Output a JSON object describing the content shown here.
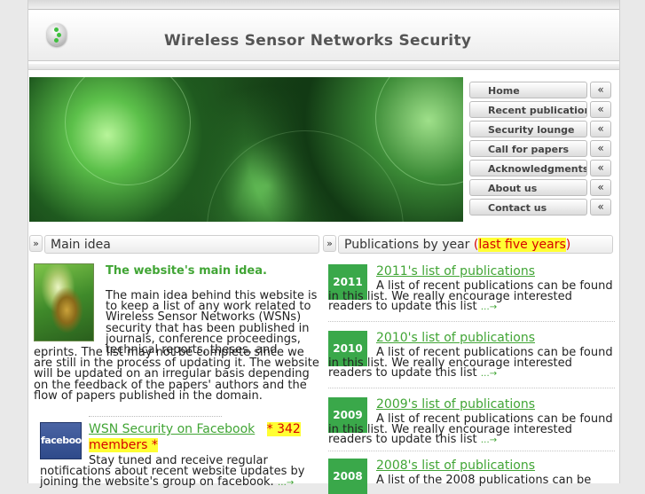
{
  "header": {
    "site_title": "Wireless Sensor Networks Security"
  },
  "nav": {
    "items": [
      {
        "label": "Home",
        "arrow": "«"
      },
      {
        "label": "Recent publications",
        "arrow": "«"
      },
      {
        "label": "Security lounge",
        "arrow": "«"
      },
      {
        "label": "Call for papers",
        "arrow": "«"
      },
      {
        "label": "Acknowledgments",
        "arrow": "«"
      },
      {
        "label": "About us",
        "arrow": "«"
      },
      {
        "label": "Contact us",
        "arrow": "«"
      }
    ]
  },
  "left": {
    "head_arrow": "»",
    "head_title": "Main idea",
    "idea_title": "The website's main idea.",
    "idea_text_1": "The main idea behind this website is to keep a list of  any work related to Wireless Sensor Networks (WSNs) security that has been published in journals, conference proceedings, technical reports, theses, and",
    "idea_text_2": "eprints. The list may not be complete since we are still in the process of updating it. The website will be updated on an irregular basis depending on the feedback of the papers' authors and the flow of papers published in the domain.",
    "fb_logo_text": "facebook",
    "fb_title": "WSN Security on Facebook",
    "fb_members": "* 342 members *",
    "fb_text": "Stay tuned and receive regular notifications about recent website updates by joining the website's group on facebook.",
    "more_link": "…→"
  },
  "right": {
    "head_arrow": "»",
    "head_title": "Publications by year",
    "head_paren_open": "(",
    "head_highlight": "last five years",
    "head_paren_close": ")",
    "publications": [
      {
        "year": "2011",
        "title": "2011's list of publications",
        "desc": "A list of recent publications can be found in this list. We really encourage interested readers to update this list",
        "more": "…→"
      },
      {
        "year": "2010",
        "title": "2010's list of publications",
        "desc": "A list of recent publications can be found in this list. We really encourage interested readers to update this list",
        "more": "…→"
      },
      {
        "year": "2009",
        "title": "2009's list of publications",
        "desc": "A list of recent publications can be found in this list. We really encourage interested readers to update this list",
        "more": "…→"
      },
      {
        "year": "2008",
        "title": "2008's list of publications",
        "desc": "A list of the 2008 publications can be",
        "more": ""
      }
    ]
  },
  "colors": {
    "accent_green": "#41a535",
    "year_box": "#3aa84a",
    "highlight_bg": "#ffff33",
    "highlight_fg": "#d60000"
  }
}
